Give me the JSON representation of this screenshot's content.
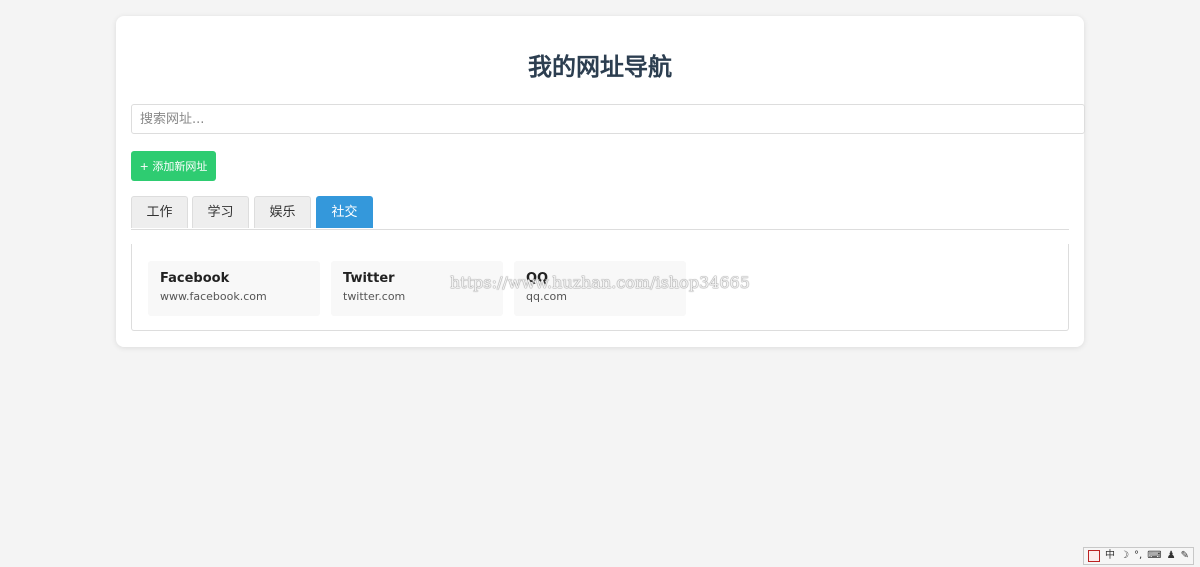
{
  "header": {
    "title": "我的网址导航"
  },
  "search": {
    "placeholder": "搜索网址...",
    "value": ""
  },
  "toolbar": {
    "add_label": "+ 添加新网址"
  },
  "tabs": [
    {
      "label": "工作",
      "active": false
    },
    {
      "label": "学习",
      "active": false
    },
    {
      "label": "娱乐",
      "active": false
    },
    {
      "label": "社交",
      "active": true
    }
  ],
  "sites": [
    {
      "name": "Facebook",
      "url": "www.facebook.com"
    },
    {
      "name": "Twitter",
      "url": "twitter.com"
    },
    {
      "name": "QQ",
      "url": "qq.com"
    }
  ],
  "watermark": "https://www.huzhan.com/ishop34665",
  "ime_toolbar": {
    "mode_label": "中",
    "icons": [
      "ime-logo-icon",
      "ime-mode-icon",
      "moon-icon",
      "punctuation-icon",
      "keyboard-icon",
      "user-icon",
      "wrench-icon"
    ]
  },
  "colors": {
    "add_button": "#2ecc71",
    "active_tab": "#3498db",
    "title": "#2c3e50",
    "background": "#f4f4f4"
  }
}
